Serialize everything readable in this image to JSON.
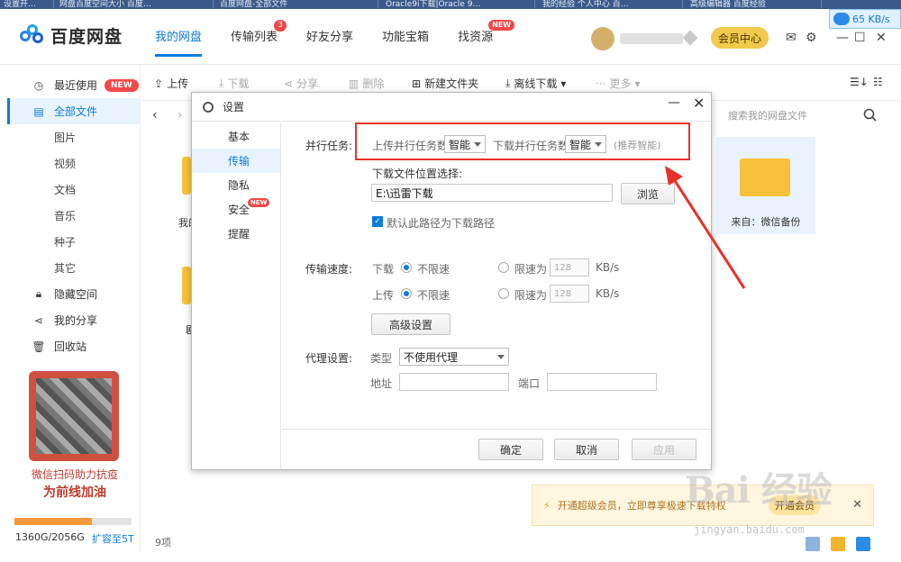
{
  "browser": {
    "tabs": [
      "设置开…",
      "网盘百度空间大小 百度…",
      "百度网盘-全部文件",
      "Oracle9i下载|Oracle 9…",
      "我的经验 个人中心 百…",
      "高级编辑器 百度经验"
    ],
    "speed": "65 KB/s"
  },
  "header": {
    "logo": "百度网盘",
    "nav": [
      {
        "label": "我的网盘",
        "active": true
      },
      {
        "label": "传输列表",
        "badge": "3"
      },
      {
        "label": "好友分享"
      },
      {
        "label": "功能宝箱"
      },
      {
        "label": "找资源",
        "new_badge": "NEW"
      }
    ],
    "vip_button": "会员中心",
    "icons": [
      "mail-icon",
      "settings-icon",
      "minimize-icon",
      "maximize-icon",
      "close-icon"
    ]
  },
  "sidebar": {
    "items": [
      {
        "label": "最近使用",
        "icon": "clock-icon",
        "new_badge": "NEW"
      },
      {
        "label": "全部文件",
        "icon": "file-icon",
        "active": true
      },
      {
        "label": "图片"
      },
      {
        "label": "视频"
      },
      {
        "label": "文档"
      },
      {
        "label": "音乐"
      },
      {
        "label": "种子"
      },
      {
        "label": "其它"
      },
      {
        "label": "隐藏空间",
        "icon": "lock-icon"
      },
      {
        "label": "我的分享",
        "icon": "share-icon"
      },
      {
        "label": "回收站",
        "icon": "trash-icon"
      }
    ],
    "promo_line1": "微信扫码助力抗疫",
    "promo_line2": "为前线加油",
    "storage_text": "1360G/2056G",
    "storage_used_fraction": 0.66,
    "expand_link": "扩容至5T"
  },
  "toolbar": {
    "upload": "上传",
    "download": "下载",
    "share": "分享",
    "delete": "删除",
    "new_folder": "新建文件夹",
    "offline_download": "离线下载",
    "more": "更多"
  },
  "search": {
    "placeholder": "搜索我的网盘文件"
  },
  "files": {
    "visible_card": "来自：微信备份",
    "partial_label_1": "我的",
    "partial_label_2": "剧",
    "item_count": "9项"
  },
  "upsell": {
    "text": "开通超级会员，立即尊享极速下载特权",
    "button": "开通会员"
  },
  "watermark": {
    "text": "Bai 经验",
    "url": "jingyan.baidu.com"
  },
  "dialog": {
    "title": "设置",
    "nav": [
      {
        "label": "基本"
      },
      {
        "label": "传输",
        "active": true
      },
      {
        "label": "隐私"
      },
      {
        "label": "安全",
        "new_badge": "NEW"
      },
      {
        "label": "提醒"
      }
    ],
    "parallel": {
      "label": "并行任务:",
      "upload_label": "上传并行任务数",
      "upload_value": "智能",
      "download_label": "下载并行任务数",
      "download_value": "智能",
      "hint": "(推荐智能)"
    },
    "download_path": {
      "label": "下载文件位置选择:",
      "value": "E:\\迅雷下载",
      "browse": "浏览",
      "default_checkbox": "默认此路径为下载路径",
      "default_checked": true
    },
    "speed": {
      "label": "传输速度:",
      "download_label": "下载",
      "upload_label": "上传",
      "unlimited": "不限速",
      "limit": "限速为",
      "download_limit_value": "128",
      "upload_limit_value": "128",
      "unit": "KB/s",
      "advanced_button": "高级设置"
    },
    "proxy": {
      "label": "代理设置:",
      "type_label": "类型",
      "type_value": "不使用代理",
      "address_label": "地址",
      "port_label": "端口"
    },
    "buttons": {
      "ok": "确定",
      "cancel": "取消",
      "apply": "应用"
    }
  }
}
